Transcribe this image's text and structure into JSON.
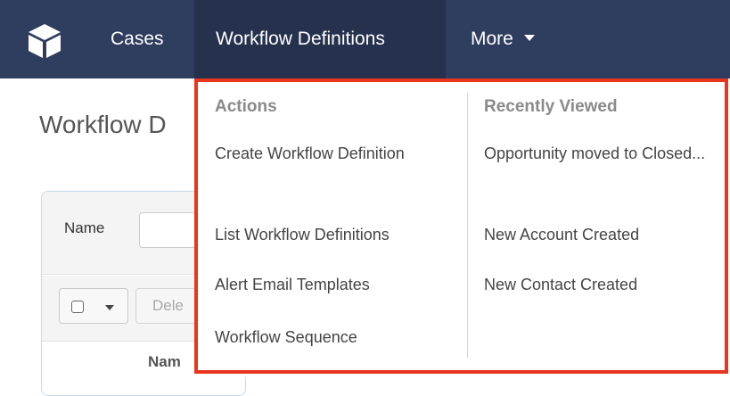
{
  "nav": {
    "logo_icon": "cube-icon",
    "items": [
      {
        "label": "Cases"
      },
      {
        "label": "Workflow Definitions"
      },
      {
        "label": "More"
      }
    ],
    "colors": {
      "bar": "#2f3d5e",
      "active": "#25314d",
      "text": "#ffffff"
    }
  },
  "page": {
    "title": "Workflow D",
    "filter_label": "Name",
    "delete_label": "Dele",
    "column_header": "Nam"
  },
  "dropdown": {
    "actions_heading": "Actions",
    "actions": [
      {
        "label": "Create Workflow Definition"
      },
      {
        "label": "List Workflow Definitions"
      },
      {
        "label": "Alert Email Templates"
      },
      {
        "label": "Workflow Sequence"
      }
    ],
    "recent_heading": "Recently Viewed",
    "recent": [
      {
        "label": "Opportunity moved to Closed..."
      },
      {
        "label": "New Account Created"
      },
      {
        "label": "New Contact Created"
      }
    ],
    "highlight_color": "#e8361e"
  }
}
